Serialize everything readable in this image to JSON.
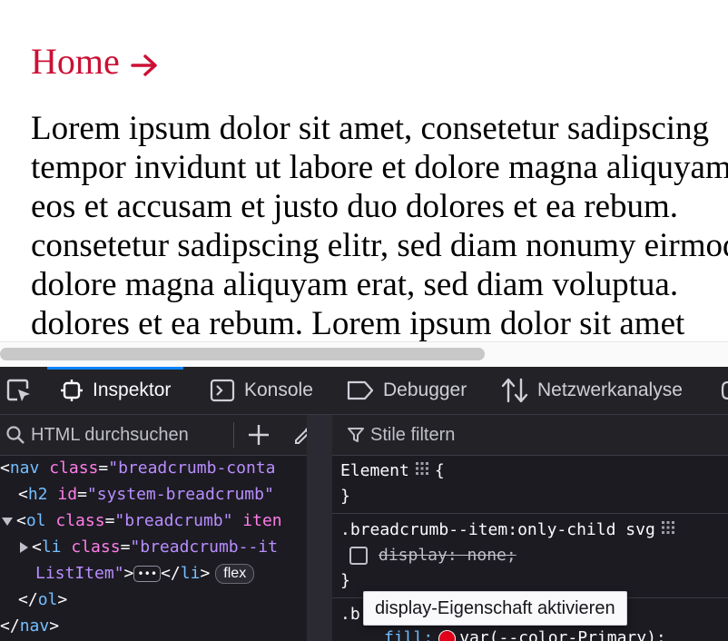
{
  "page": {
    "breadcrumb_link": "Home",
    "paragraph_lines": [
      "Lorem ipsum dolor sit amet, consetetur sadipscing",
      "tempor invidunt ut labore et dolore magna aliquyam",
      "eos et accusam et justo duo dolores et ea rebum.",
      "consetetur sadipscing elitr, sed diam nonumy eirmod",
      "dolore magna aliquyam erat, sed diam voluptua.",
      "dolores et ea rebum. Lorem ipsum dolor sit amet"
    ]
  },
  "devtools": {
    "tabs": [
      {
        "label": "Inspektor",
        "icon": "inspector-icon"
      },
      {
        "label": "Konsole",
        "icon": "console-icon"
      },
      {
        "label": "Debugger",
        "icon": "debugger-icon"
      },
      {
        "label": "Netzwerkanalyse",
        "icon": "network-icon"
      }
    ],
    "inspector": {
      "search_placeholder": "HTML durchsuchen",
      "markup": {
        "l1": {
          "tag": "nav",
          "attr": "class",
          "val": "\"breadcrumb-conta"
        },
        "l2": {
          "tag": "h2",
          "attr": "id",
          "val": "\"system-breadcrumb\""
        },
        "l3": {
          "tag": "ol",
          "attr": "class",
          "val": "\"breadcrumb\"",
          "attr2": "iten"
        },
        "l4": {
          "tag": "li",
          "attr": "class",
          "val": "\"breadcrumb--it"
        },
        "l5": {
          "val": "ListItem\"",
          "close_tag": "li",
          "badge": "flex"
        },
        "l6": {
          "close_tag": "ol"
        },
        "l7": {
          "close_tag": "nav"
        }
      }
    },
    "rules": {
      "filter_placeholder": "Stile filtern",
      "element_selector": "Element",
      "selector2": ".breadcrumb--item:only-child svg",
      "disabled_decl": "display: none;",
      "selector3_start": ".b",
      "fill_prop": "fill:",
      "fill_value": "var(--color-Primary);",
      "swatch_color": "#e2001a"
    },
    "tooltip": "display-Eigenschaft aktivieren"
  },
  "colors": {
    "link": "#cc1035",
    "devtools_bg": "#1c1b22",
    "tab_accent": "#0a84ff",
    "tag": "#75bfff",
    "attr": "#ff7de9",
    "value": "#b98eff"
  }
}
